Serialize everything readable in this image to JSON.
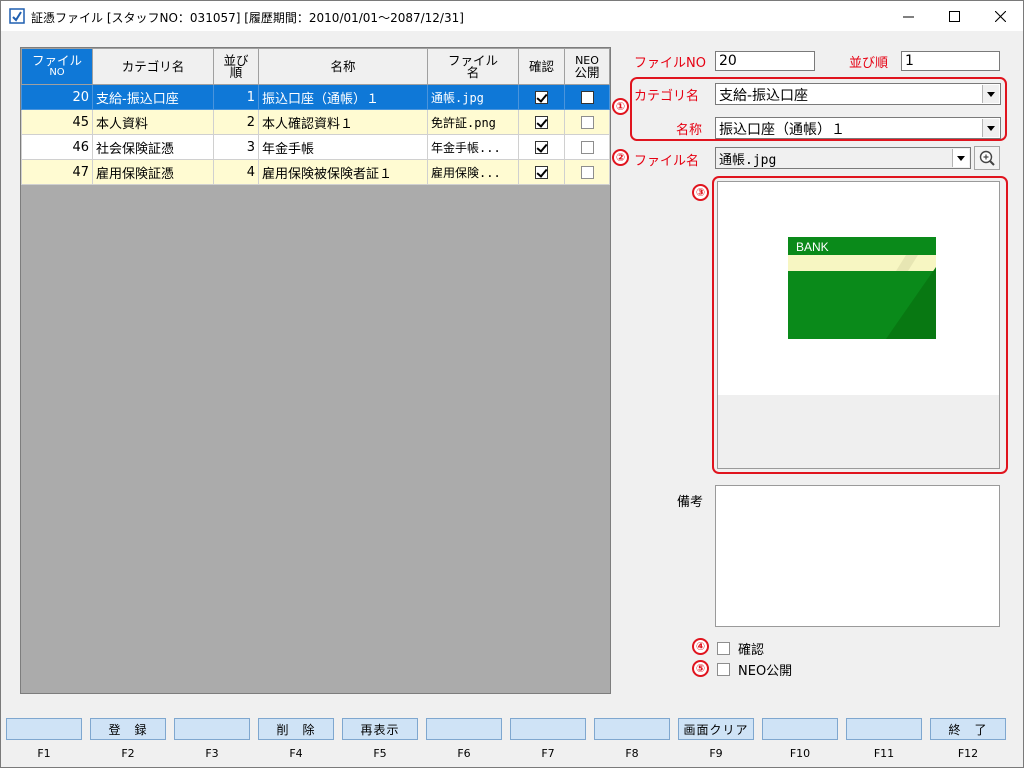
{
  "window": {
    "title": "証憑ファイル [スタッフNO：031057]  [履歴期間：2010/01/01～2087/12/31]",
    "controls": {
      "minimize": "—",
      "maximize": "☐",
      "close": "✕"
    }
  },
  "grid": {
    "headers": {
      "file_no": [
        "ファイル",
        "NO"
      ],
      "category": "カテゴリ名",
      "order": [
        "並び",
        "順"
      ],
      "name": "名称",
      "filename": [
        "ファイル",
        "名"
      ],
      "confirm": "確認",
      "neo": [
        "NEO",
        "公開"
      ]
    },
    "rows": [
      {
        "file_no": "20",
        "category": "支給-振込口座",
        "order": "1",
        "name": "振込口座（通帳）１",
        "filename": "通帳.jpg",
        "confirm": true,
        "neo": false,
        "style": "selected"
      },
      {
        "file_no": "45",
        "category": "本人資料",
        "order": "2",
        "name": "本人確認資料１",
        "filename": "免許証.png",
        "confirm": true,
        "neo": false,
        "style": "yellow"
      },
      {
        "file_no": "46",
        "category": "社会保険証憑",
        "order": "3",
        "name": "年金手帳",
        "filename": "年金手帳...",
        "confirm": true,
        "neo": false,
        "style": "white"
      },
      {
        "file_no": "47",
        "category": "雇用保険証憑",
        "order": "4",
        "name": "雇用保険被保険者証１",
        "filename": "雇用保険...",
        "confirm": true,
        "neo": false,
        "style": "yellow"
      }
    ]
  },
  "form": {
    "file_no_label": "ファイルNO",
    "file_no_value": "20",
    "order_label": "並び順",
    "order_value": "1",
    "category_label": "カテゴリ名",
    "category_value": "支給-振込口座",
    "name_label": "名称",
    "name_value": "振込口座（通帳）１",
    "filename_label": "ファイル名",
    "filename_value": "通帳.jpg",
    "preview_text": "BANK",
    "memo_label": "備考",
    "memo_value": "",
    "confirm_label": "確認",
    "neo_label": "NEO公開"
  },
  "markers": [
    "①",
    "②",
    "③",
    "④",
    "⑤"
  ],
  "colors": {
    "accent_red": "#e0141e",
    "selected_row": "#0f78d7",
    "yellow_row": "#fffbd2",
    "fkey_bg": "#cfe3f6",
    "bank_green": "#0a8a1a"
  },
  "function_keys": [
    {
      "key": "F1",
      "label": ""
    },
    {
      "key": "F2",
      "label": "登　録"
    },
    {
      "key": "F3",
      "label": ""
    },
    {
      "key": "F4",
      "label": "削　除"
    },
    {
      "key": "F5",
      "label": "再表示"
    },
    {
      "key": "F6",
      "label": ""
    },
    {
      "key": "F7",
      "label": ""
    },
    {
      "key": "F8",
      "label": ""
    },
    {
      "key": "F9",
      "label": "画面クリア"
    },
    {
      "key": "F10",
      "label": ""
    },
    {
      "key": "F11",
      "label": ""
    },
    {
      "key": "F12",
      "label": "終　了"
    }
  ]
}
